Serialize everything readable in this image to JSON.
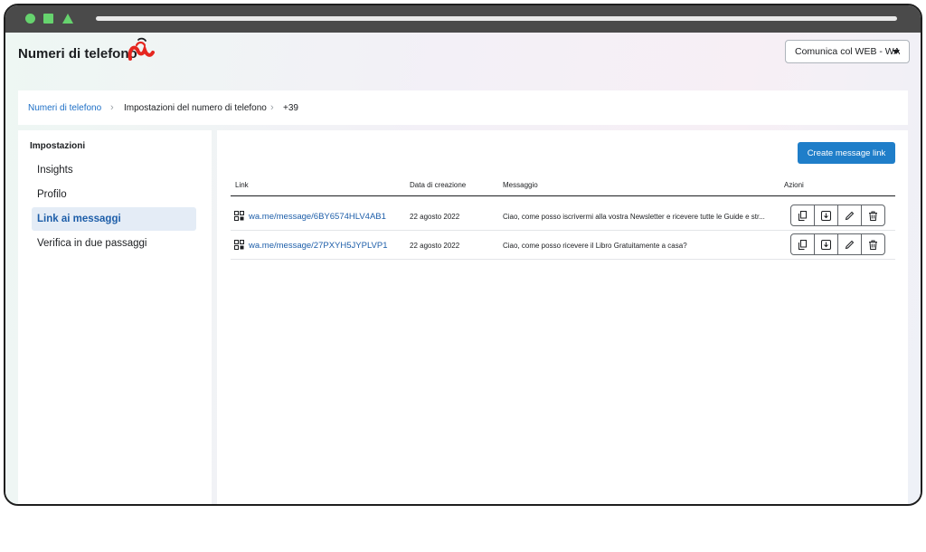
{
  "header": {
    "title": "Numeri di telefono",
    "logo_icon": "brand-logo-icon",
    "account_select": "Comunica col WEB - WA"
  },
  "breadcrumb": {
    "items": [
      "Numeri di telefono",
      "Impostazioni del numero di telefono",
      "+39"
    ]
  },
  "sidebar": {
    "heading": "Impostazioni",
    "items": [
      {
        "label": "Insights",
        "active": false
      },
      {
        "label": "Profilo",
        "active": false
      },
      {
        "label": "Link ai messaggi",
        "active": true
      },
      {
        "label": "Verifica in due passaggi",
        "active": false
      }
    ]
  },
  "main": {
    "create_button": "Create message link",
    "table": {
      "columns": [
        "Link",
        "Data di creazione",
        "Messaggio",
        "Azioni"
      ],
      "rows": [
        {
          "link": "wa.me/message/6BY6574HLV4AB1",
          "date": "22 agosto 2022",
          "message": "Ciao, come posso iscrivermi alla vostra Newsletter e ricevere tutte le Guide e str..."
        },
        {
          "link": "wa.me/message/27PXYH5JYPLVP1",
          "date": "22 agosto 2022",
          "message": "Ciao, come posso ricevere il Libro Gratuitamente a casa?"
        }
      ],
      "action_icons": [
        "copy-icon",
        "download-icon",
        "edit-icon",
        "trash-icon"
      ]
    }
  },
  "colors": {
    "accent": "#1f7ec9",
    "link": "#1d5ea9",
    "brand": "#e5261f",
    "chrome_dots": "#66d36e"
  }
}
